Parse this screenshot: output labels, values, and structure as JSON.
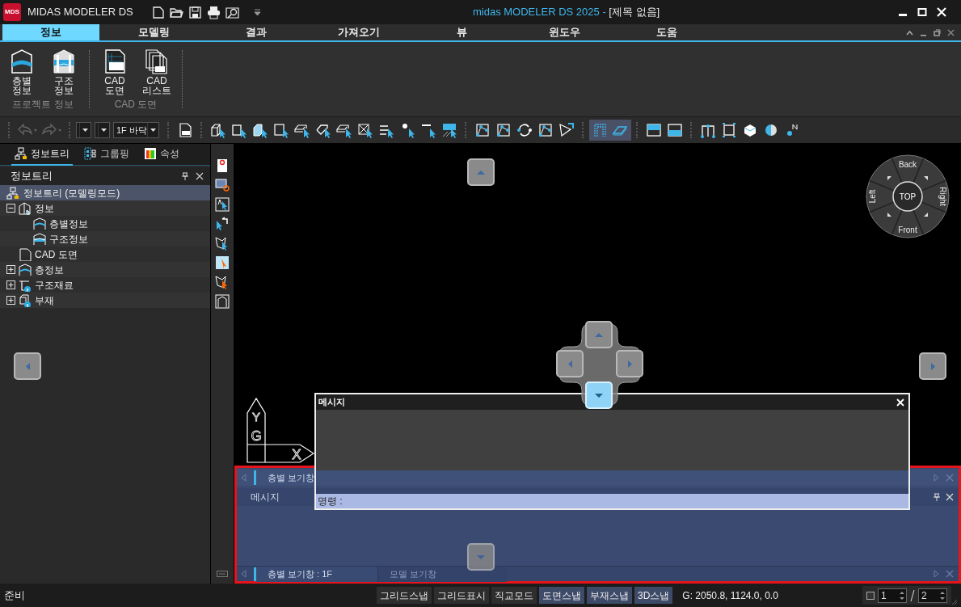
{
  "title_bar": {
    "logo": "MDS",
    "app_name": "MIDAS MODELER DS",
    "title": "midas MODELER DS 2025 - ",
    "document": "[제목 없음]"
  },
  "menu_tabs": [
    {
      "label": "정보",
      "selected": true
    },
    {
      "label": "모델링",
      "selected": false
    },
    {
      "label": "결과",
      "selected": false
    },
    {
      "label": "가져오기",
      "selected": false
    },
    {
      "label": "뷰",
      "selected": false
    },
    {
      "label": "윈도우",
      "selected": false
    },
    {
      "label": "도움",
      "selected": false
    }
  ],
  "ribbon": {
    "groups": [
      {
        "label": "프로젝트 정보",
        "buttons": [
          {
            "kind": "floor",
            "lines": [
              "층별",
              "정보"
            ]
          },
          {
            "kind": "structure",
            "lines": [
              "구조",
              "정보"
            ]
          }
        ]
      },
      {
        "label": "CAD 도면",
        "buttons": [
          {
            "kind": "cad",
            "lines": [
              "CAD",
              "도면"
            ]
          },
          {
            "kind": "cadlist",
            "lines": [
              "CAD",
              "리스트"
            ]
          }
        ]
      }
    ]
  },
  "toolbar": {
    "floor_select": "1F 바닥",
    "toggle_buttons": [
      {
        "kind": "frame",
        "selected": true
      },
      {
        "kind": "plane",
        "selected": true
      }
    ]
  },
  "left_panel": {
    "tabs": [
      {
        "label": "정보트리",
        "kind": "tree",
        "selected": true
      },
      {
        "label": "그룹핑",
        "kind": "group",
        "selected": false
      },
      {
        "label": "속성",
        "kind": "props",
        "selected": false
      }
    ],
    "title": "정보트리",
    "tree": [
      {
        "label": "정보트리 (모델링모드)",
        "kind": "root",
        "selected": true,
        "children": [
          {
            "label": "정보",
            "kind": "building",
            "selected": false,
            "expanded": true,
            "children": [
              {
                "label": "층별정보",
                "kind": "floor",
                "selected": false
              },
              {
                "label": "구조정보",
                "kind": "structure",
                "selected": false
              }
            ]
          },
          {
            "label": "CAD 도면",
            "kind": "cad",
            "selected": false
          },
          {
            "label": "층정보",
            "kind": "floor",
            "selected": false,
            "expanded": false
          },
          {
            "label": "구조재료",
            "kind": "material",
            "selected": false,
            "expanded": false
          },
          {
            "label": "부재",
            "kind": "member",
            "selected": false,
            "expanded": false
          }
        ]
      }
    ]
  },
  "viewport": {
    "view_cube": {
      "center": "TOP",
      "back": "Back",
      "front": "Front",
      "left": "Left",
      "right": "Right"
    },
    "axis": {
      "y": "Y",
      "g": "G",
      "x": "X"
    },
    "direction_pad": [
      {
        "kind": "up",
        "selected": false
      },
      {
        "kind": "left",
        "selected": false
      },
      {
        "kind": "right",
        "selected": false
      },
      {
        "kind": "down",
        "selected": true
      }
    ]
  },
  "message_dialog": {
    "title": "메시지",
    "command_label": "명령 :"
  },
  "dock_panel": {
    "top_tab": "층별 보기창",
    "title": "메시지",
    "bottom_tabs": [
      {
        "label": "층별 보기창 : 1F",
        "selected": true
      },
      {
        "label": "모델 보기창",
        "selected": false
      }
    ]
  },
  "status_bar": {
    "text": "준비",
    "toggles": [
      {
        "label": "그리드스냅",
        "on": false
      },
      {
        "label": "그리드표시",
        "on": false
      },
      {
        "label": "직교모드",
        "on": false
      },
      {
        "label": "도면스냅",
        "on": true
      },
      {
        "label": "부재스냅",
        "on": true
      },
      {
        "label": "3D스냅",
        "on": true
      }
    ],
    "coords": "G: 2050.8, 1124.0, 0.0",
    "page_checkbox": {
      "checked": false
    },
    "page": "1",
    "page_total": "2"
  }
}
